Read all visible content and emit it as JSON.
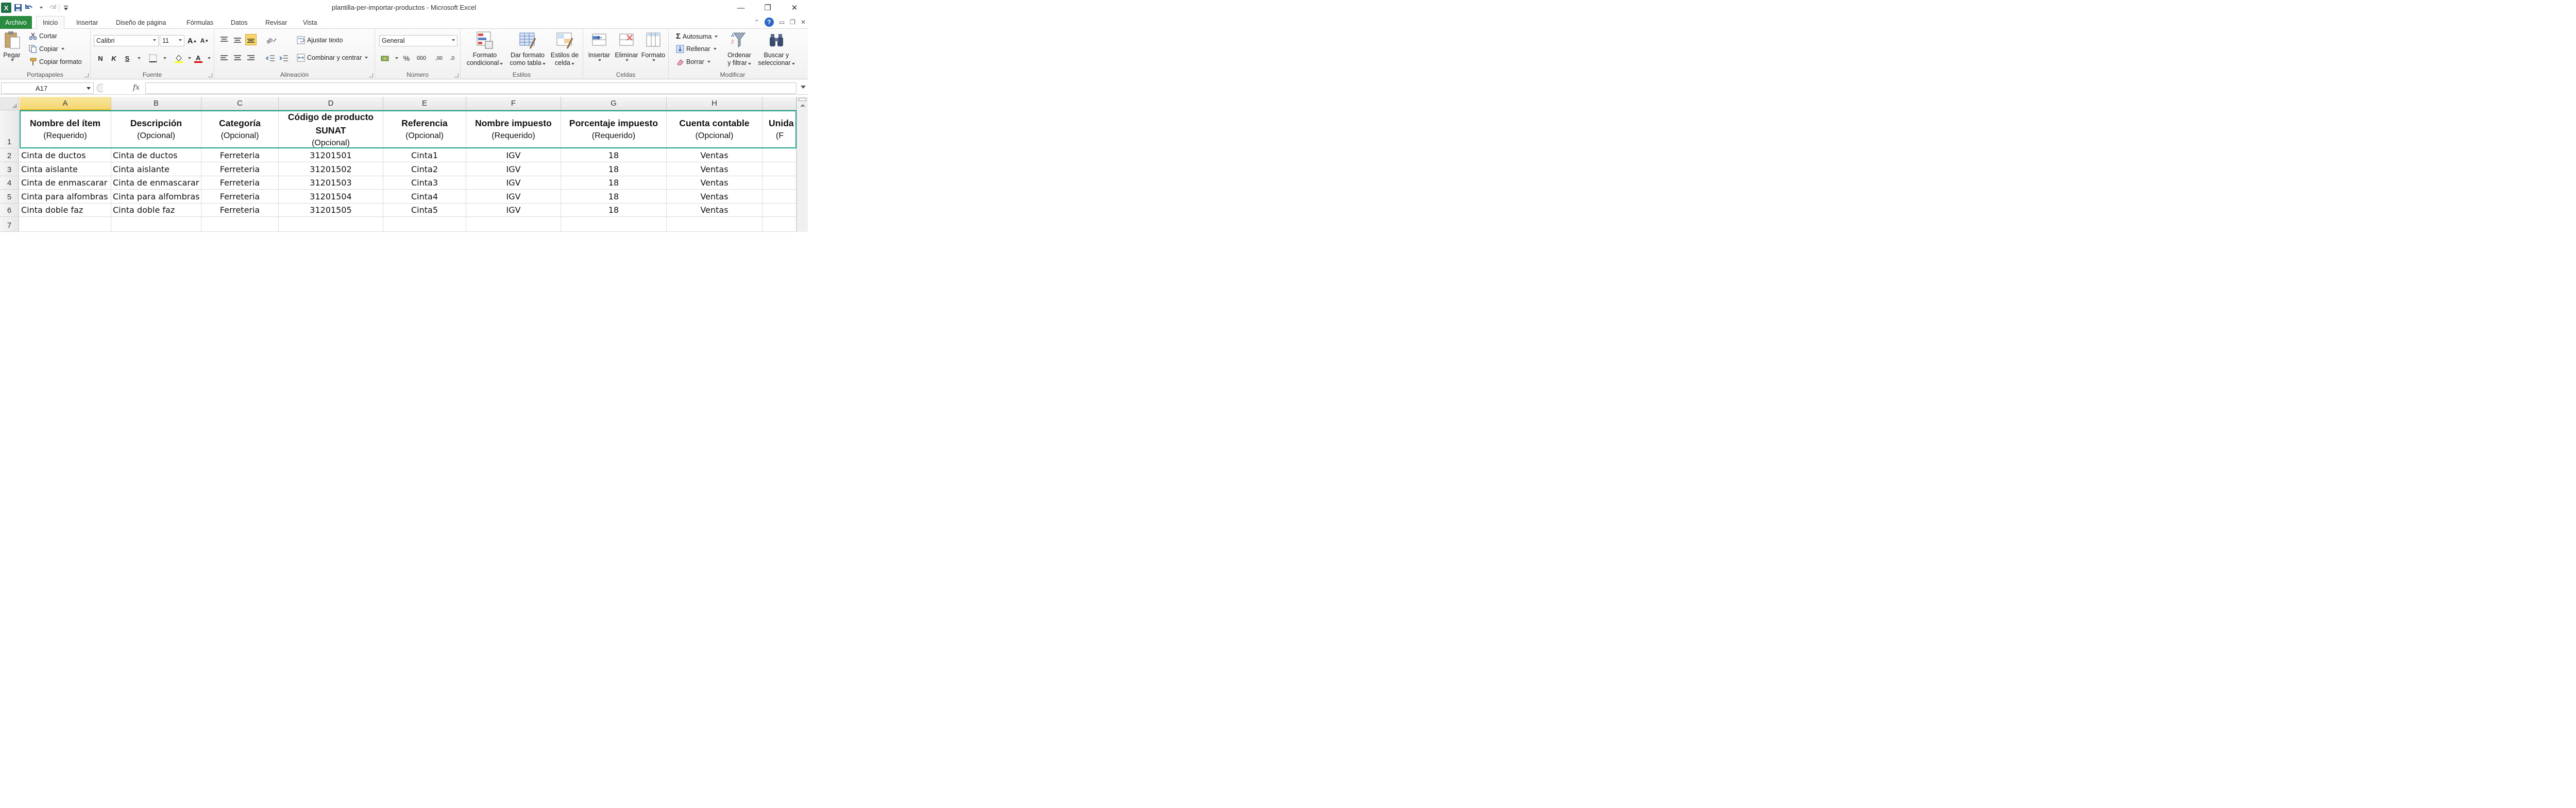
{
  "window": {
    "title": "plantilla-per-importar-productos  -  Microsoft Excel"
  },
  "quick_access": [
    "excel-logo-icon",
    "save-icon",
    "undo-icon",
    "redo-icon",
    "customize-icon"
  ],
  "tabs": [
    "Archivo",
    "Inicio",
    "Insertar",
    "Diseño de página",
    "Fórmulas",
    "Datos",
    "Revisar",
    "Vista"
  ],
  "active_tab": "Inicio",
  "ribbon": {
    "clipboard": {
      "label": "Portapapeles",
      "paste": "Pegar",
      "cut": "Cortar",
      "copy": "Copiar",
      "format_painter": "Copiar formato"
    },
    "font": {
      "label": "Fuente",
      "font_name": "Calibri",
      "font_size": "11",
      "bold": "N",
      "italic": "K",
      "underline": "S"
    },
    "alignment": {
      "label": "Alineación",
      "wrap_text": "Ajustar texto",
      "merge_center": "Combinar y centrar"
    },
    "number": {
      "label": "Número",
      "format": "General",
      "percent": "%",
      "thousands": "000",
      "inc_decimal": ",00",
      "dec_decimal": ",0"
    },
    "styles": {
      "label": "Estilos",
      "conditional_l1": "Formato",
      "conditional_l2": "condicional",
      "table_l1": "Dar formato",
      "table_l2": "como tabla",
      "cell_styles_l1": "Estilos de",
      "cell_styles_l2": "celda"
    },
    "cells": {
      "label": "Celdas",
      "insert": "Insertar",
      "delete": "Eliminar",
      "format": "Formato"
    },
    "editing": {
      "label": "Modificar",
      "autosum": "Autosuma",
      "fill": "Rellenar",
      "clear": "Borrar",
      "sort_l1": "Ordenar",
      "sort_l2": "y filtrar",
      "find_l1": "Buscar y",
      "find_l2": "seleccionar"
    }
  },
  "formula_bar": {
    "name_box": "A17",
    "fx": "fx",
    "formula": ""
  },
  "columns": [
    "A",
    "B",
    "C",
    "D",
    "E",
    "F",
    "G",
    "H"
  ],
  "selected_column": "A",
  "rows": [
    "1",
    "2",
    "3",
    "4",
    "5",
    "6",
    "7"
  ],
  "header_row": {
    "A": {
      "title": "Nombre del ítem",
      "sub": "(Requerido)"
    },
    "B": {
      "title": "Descripción",
      "sub": "(Opcional)"
    },
    "C": {
      "title": "Categoría",
      "sub": "(Opcional)"
    },
    "D": {
      "title": "Código de producto",
      "title2": "SUNAT",
      "sub": "(Opcional)"
    },
    "E": {
      "title": "Referencia",
      "sub": "(Opcional)"
    },
    "F": {
      "title": "Nombre impuesto",
      "sub": "(Requerido)"
    },
    "G": {
      "title": "Porcentaje impuesto",
      "sub": "(Requerido)"
    },
    "H": {
      "title": "Cuenta contable",
      "sub": "(Opcional)"
    },
    "I": {
      "title": "Unida",
      "sub": "(F"
    }
  },
  "data_rows": [
    [
      "Cinta de ductos",
      "Cinta de ductos",
      "Ferreteria",
      "31201501",
      "Cinta1",
      "IGV",
      "18",
      "Ventas"
    ],
    [
      "Cinta aislante",
      "Cinta aislante",
      "Ferreteria",
      "31201502",
      "Cinta2",
      "IGV",
      "18",
      "Ventas"
    ],
    [
      "Cinta de enmascarar",
      "Cinta de enmascarar",
      "Ferreteria",
      "31201503",
      "Cinta3",
      "IGV",
      "18",
      "Ventas"
    ],
    [
      "Cinta para alfombras",
      "Cinta para alfombras",
      "Ferreteria",
      "31201504",
      "Cinta4",
      "IGV",
      "18",
      "Ventas"
    ],
    [
      "Cinta doble faz",
      "Cinta doble faz",
      "Ferreteria",
      "31201505",
      "Cinta5",
      "IGV",
      "18",
      "Ventas"
    ]
  ],
  "colors": {
    "file_tab": "#2a8a3e",
    "selection_border": "#1a9f8a",
    "selected_column_header": "#f3d66d"
  }
}
